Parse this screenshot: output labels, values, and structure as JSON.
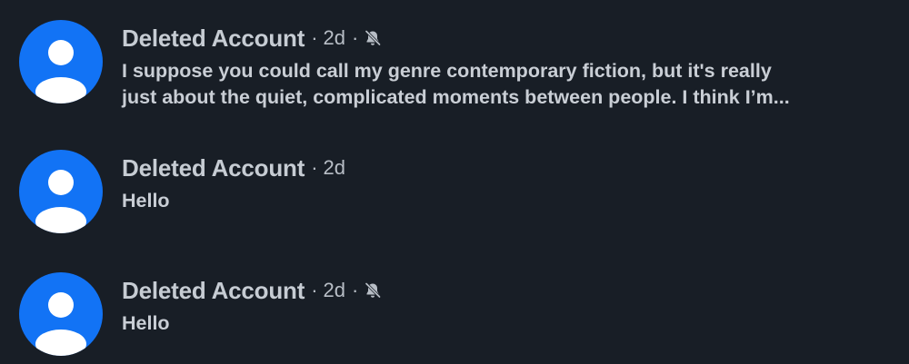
{
  "conversations": [
    {
      "name": "Deleted Account",
      "time": "2d",
      "separator": "·",
      "muted": true,
      "message_lines": [
        "I suppose you could call my genre contemporary fiction, but it's really",
        "just about the quiet, complicated moments between people. I think I’m..."
      ],
      "avatar_icon": "default-user-icon",
      "mute_icon": "bell-off-icon"
    },
    {
      "name": "Deleted Account",
      "time": "2d",
      "separator": "·",
      "muted": false,
      "message_lines": [
        "Hello"
      ],
      "avatar_icon": "default-user-icon"
    },
    {
      "name": "Deleted Account",
      "time": "2d",
      "separator": "·",
      "muted": true,
      "message_lines": [
        "Hello"
      ],
      "avatar_icon": "default-user-icon",
      "mute_icon": "bell-off-icon"
    }
  ],
  "colors": {
    "background": "#181e26",
    "avatar": "#1273f5",
    "name_text": "#c6ccd3",
    "meta_text": "#b8bec6"
  }
}
